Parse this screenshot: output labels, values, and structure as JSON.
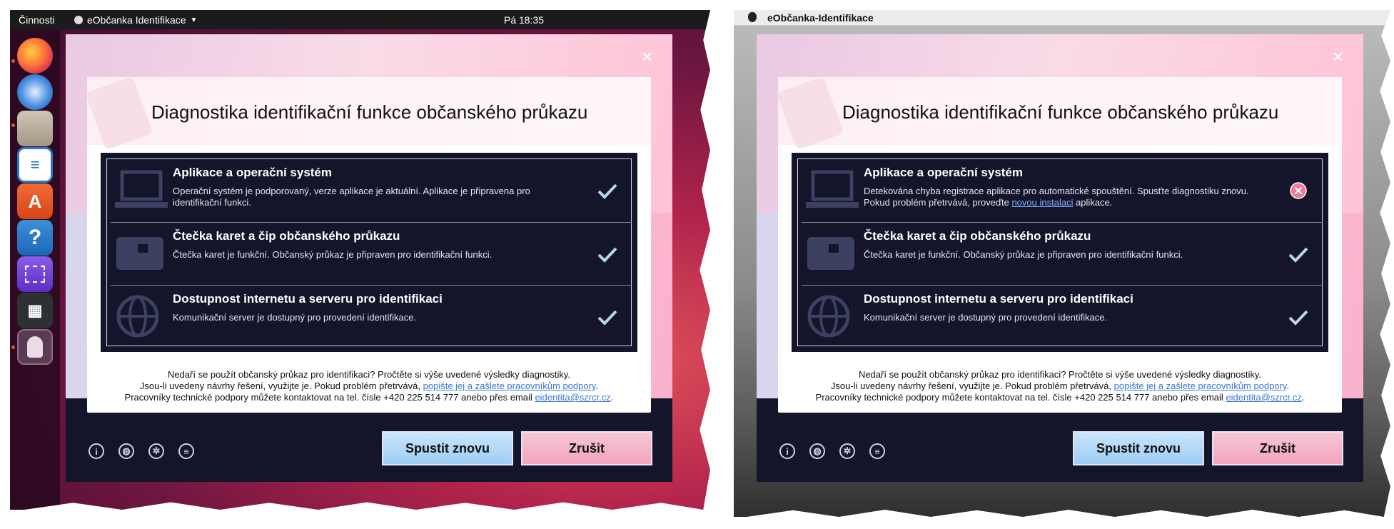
{
  "ubuntu": {
    "topbar": {
      "activities": "Činnosti",
      "app_name": "eObčanka Identifikace",
      "clock": "Pá 18:35"
    },
    "dock": {
      "items": [
        {
          "name": "firefox"
        },
        {
          "name": "thunderbird"
        },
        {
          "name": "files"
        },
        {
          "name": "libreoffice-writer"
        },
        {
          "name": "ubuntu-software"
        },
        {
          "name": "help"
        },
        {
          "name": "screenshot"
        },
        {
          "name": "video"
        },
        {
          "name": "eobcanka"
        }
      ]
    }
  },
  "mac": {
    "menubar": {
      "app_name": "eObčanka-Identifikace"
    }
  },
  "dialog": {
    "title": "Diagnostika identifikační funkce občanského průkazu",
    "close_glyph": "×",
    "rows": [
      {
        "title": "Aplikace a operační systém",
        "ubuntu_text": "Operační systém je podporovaný, verze aplikace je aktuální. Aplikace je připravena pro identifikační funkci.",
        "mac_text_before": "Detekována chyba registrace aplikace pro automatické spouštění. Spusťte diagnostiku znovu. Pokud problém přetrvává, proveďte",
        "mac_link": "novou instalaci",
        "mac_text_after": "aplikace.",
        "ubuntu_status": "ok",
        "mac_status": "error"
      },
      {
        "title": "Čtečka karet a čip občanského průkazu",
        "ubuntu_text": "Čtečka karet je funkční. Občanský průkaz je připraven pro identifikační funkci.",
        "ubuntu_status": "ok",
        "mac_status": "ok"
      },
      {
        "title": "Dostupnost internetu a serveru pro identifikaci",
        "ubuntu_text": "Komunikační server je dostupný pro provedení identifikace.",
        "ubuntu_status": "ok",
        "mac_status": "ok"
      }
    ],
    "footer": {
      "line1": "Nedaří se použít občanský průkaz pro identifikaci? Pročtěte si výše uvedené výsledky diagnostiky.",
      "line2_text": "Jsou-li uvedeny návrhy řešení, využijte je. Pokud problém přetrvává,",
      "line2_link": "popište jej a zašlete pracovníkům podpory",
      "line2_end": ".",
      "line3_text": "Pracovníky technické podpory můžete kontaktovat na tel. čísle +420 225 514 777 anebo přes email",
      "line3_link": "eidentita@szrcr.cz",
      "line3_end": "."
    },
    "bottom_icons": [
      "info-icon",
      "globe-icon",
      "settings-icon",
      "chat-icon"
    ],
    "buttons": {
      "retry": "Spustit znovu",
      "cancel": "Zrušit"
    },
    "colors": {
      "retry": "#b5daf7",
      "cancel": "#f5b4c9",
      "dark": "#14142b",
      "error": "#f07a98"
    }
  }
}
